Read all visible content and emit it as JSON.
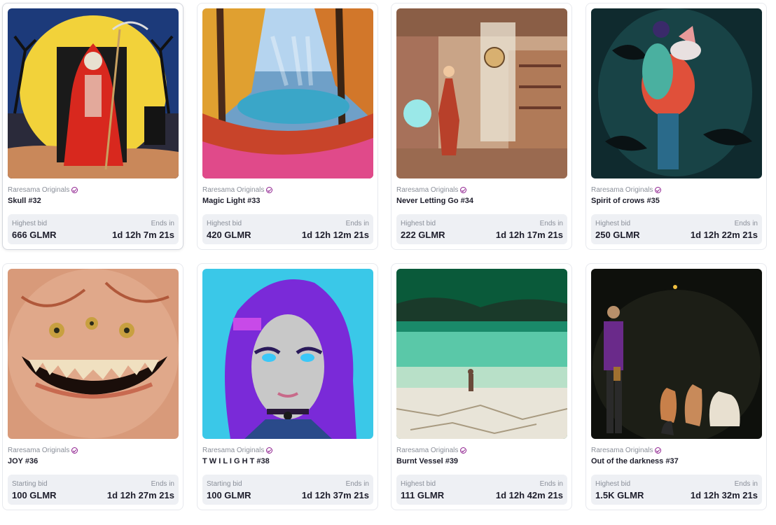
{
  "colors": {
    "verified": "#8e1e8e",
    "bid_box": "#eef0f4",
    "muted_text": "#8a8f99"
  },
  "cards": [
    {
      "collection": "Raresama Originals",
      "title": "Skull #32",
      "bid_label": "Highest bid",
      "bid_value": "666 GLMR",
      "ends_label": "Ends in",
      "ends_value": "1d 12h 7m 21s",
      "art_icon": "grim-reaper-art"
    },
    {
      "collection": "Raresama Originals",
      "title": "Magic Light #33",
      "bid_label": "Highest bid",
      "bid_value": "420 GLMR",
      "ends_label": "Ends in",
      "ends_value": "1d 12h 12m 21s",
      "art_icon": "autumn-forest-art"
    },
    {
      "collection": "Raresama Originals",
      "title": "Never Letting Go #34",
      "bid_label": "Highest bid",
      "bid_value": "222 GLMR",
      "ends_label": "Ends in",
      "ends_value": "1d 12h 17m 21s",
      "art_icon": "witch-shop-art"
    },
    {
      "collection": "Raresama Originals",
      "title": "Spirit of crows #35",
      "bid_label": "Highest bid",
      "bid_value": "250 GLMR",
      "ends_label": "Ends in",
      "ends_value": "1d 12h 22m 21s",
      "art_icon": "crow-spirit-art"
    },
    {
      "collection": "Raresama Originals",
      "title": "JOY #36",
      "bid_label": "Starting bid",
      "bid_value": "100 GLMR",
      "ends_label": "Ends in",
      "ends_value": "1d 12h 27m 21s",
      "art_icon": "grinning-monster-art"
    },
    {
      "collection": "Raresama Originals",
      "title": "T W I L I G H T #38",
      "bid_label": "Starting bid",
      "bid_value": "100 GLMR",
      "ends_label": "Ends in",
      "ends_value": "1d 12h 37m 21s",
      "art_icon": "purple-hair-girl-art"
    },
    {
      "collection": "Raresama Originals",
      "title": "Burnt Vessel #39",
      "bid_label": "Highest bid",
      "bid_value": "111 GLMR",
      "ends_label": "Ends in",
      "ends_value": "1d 12h 42m 21s",
      "art_icon": "desert-wanderer-art"
    },
    {
      "collection": "Raresama Originals",
      "title": "Out of the darkness #37",
      "bid_label": "Highest bid",
      "bid_value": "1.5K GLMR",
      "ends_label": "Ends in",
      "ends_value": "1d 12h 32m 21s",
      "art_icon": "man-with-dogs-art"
    }
  ]
}
